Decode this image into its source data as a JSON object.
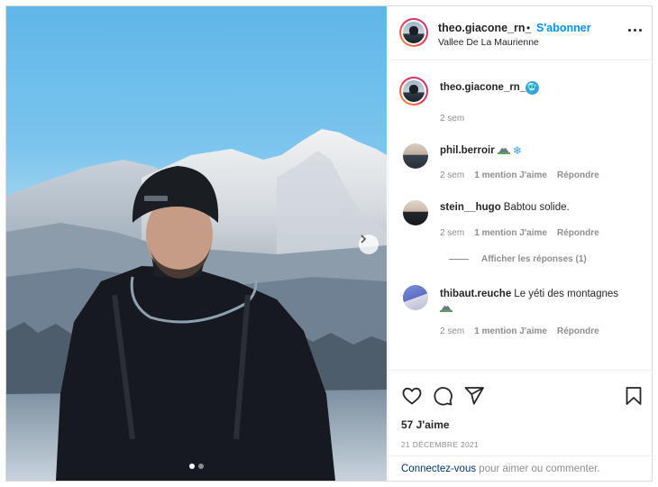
{
  "post": {
    "username": "theo.giacone_rn_",
    "separator": "•",
    "follow_label": "S'abonner",
    "location": "Vallee De La Maurienne",
    "carousel_total": 2,
    "carousel_current": 1
  },
  "caption": {
    "username": "theo.giacone_rn_",
    "emoji": "🥶",
    "time": "2 sem"
  },
  "comments": [
    {
      "username": "phil.berroir",
      "text": "",
      "emoji": [
        "mountain",
        "snowflake"
      ],
      "time": "2 sem",
      "likes": "1 mention J'aime",
      "reply": "Répondre"
    },
    {
      "username": "stein__hugo",
      "text": "Babtou solide.",
      "time": "2 sem",
      "likes": "1 mention J'aime",
      "reply": "Répondre"
    },
    {
      "username": "thibaut.reuche",
      "text": "Le yéti des montagnes",
      "emoji": [
        "mountain"
      ],
      "time": "2 sem",
      "likes": "1 mention J'aime",
      "reply": "Répondre"
    }
  ],
  "replies_link": "Afficher les réponses (1)",
  "likes_count": "57 J'aime",
  "date": "21 DÉCEMBRE 2021",
  "login": {
    "link": "Connectez-vous",
    "rest": " pour aimer ou commenter."
  },
  "icons": {
    "like": "heart-icon",
    "comment": "speech-bubble-icon",
    "share": "paper-plane-icon",
    "save": "bookmark-icon",
    "more": "ellipsis-icon",
    "next": "chevron-right-icon",
    "mountain": "mountain-icon",
    "snowflake": "snowflake-icon"
  },
  "colors": {
    "accent_blue": "#0095f6",
    "link_dark": "#00376b",
    "muted": "#8e8e8e",
    "text": "#262626",
    "border": "#dbdbdb"
  }
}
